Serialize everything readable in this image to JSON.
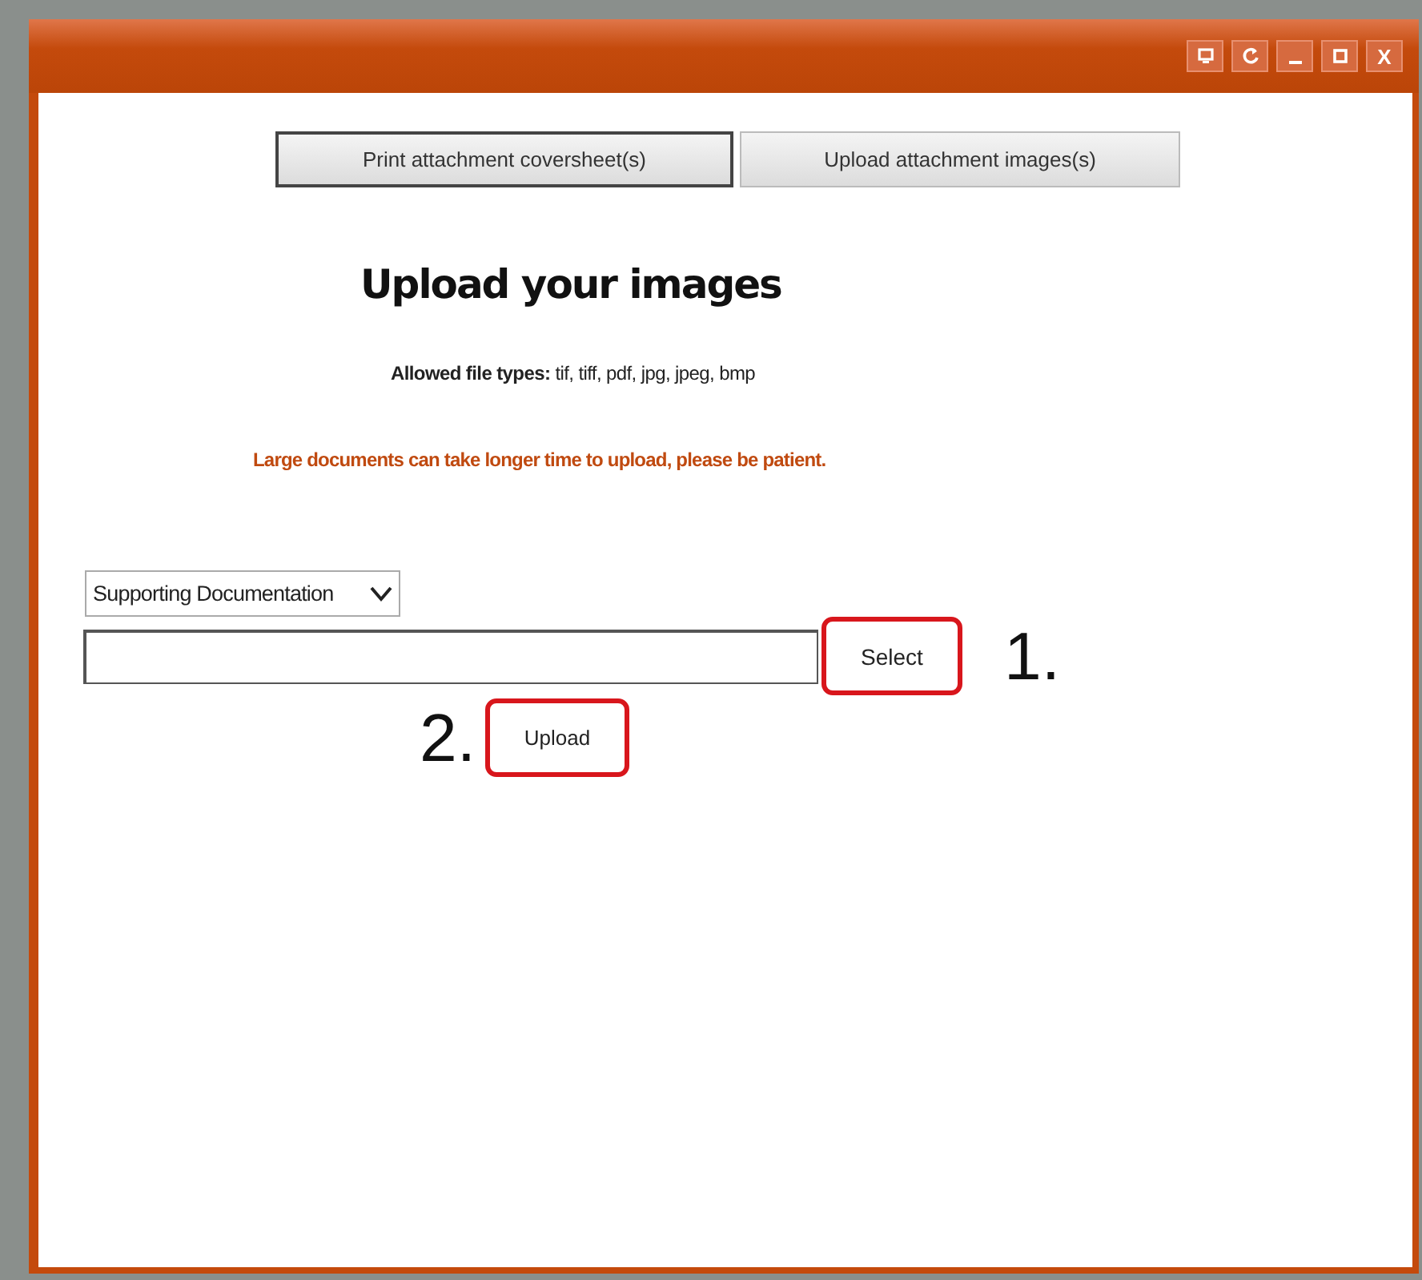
{
  "window": {
    "controls": [
      {
        "kind": "screen"
      },
      {
        "kind": "refresh"
      },
      {
        "kind": "minimize"
      },
      {
        "kind": "maximize"
      },
      {
        "kind": "close",
        "label": "X"
      }
    ]
  },
  "tabs": [
    {
      "label": "Print attachment coversheet(s)",
      "selected": true
    },
    {
      "label": "Upload attachment images(s)",
      "selected": false
    }
  ],
  "heading": "Upload your images",
  "allowed_types": "**Allowed file types:** tif, tiff, pdf, jpg, jpeg, bmp",
  "notice": "Large documents can take longer time to upload, please be patient.",
  "document_type": {
    "value": "Supporting Documentation"
  },
  "select_button": {
    "label": "Select",
    "highlighted": true,
    "step": "1."
  },
  "upload_button": {
    "label": "Upload",
    "highlighted": true,
    "step": "2."
  }
}
